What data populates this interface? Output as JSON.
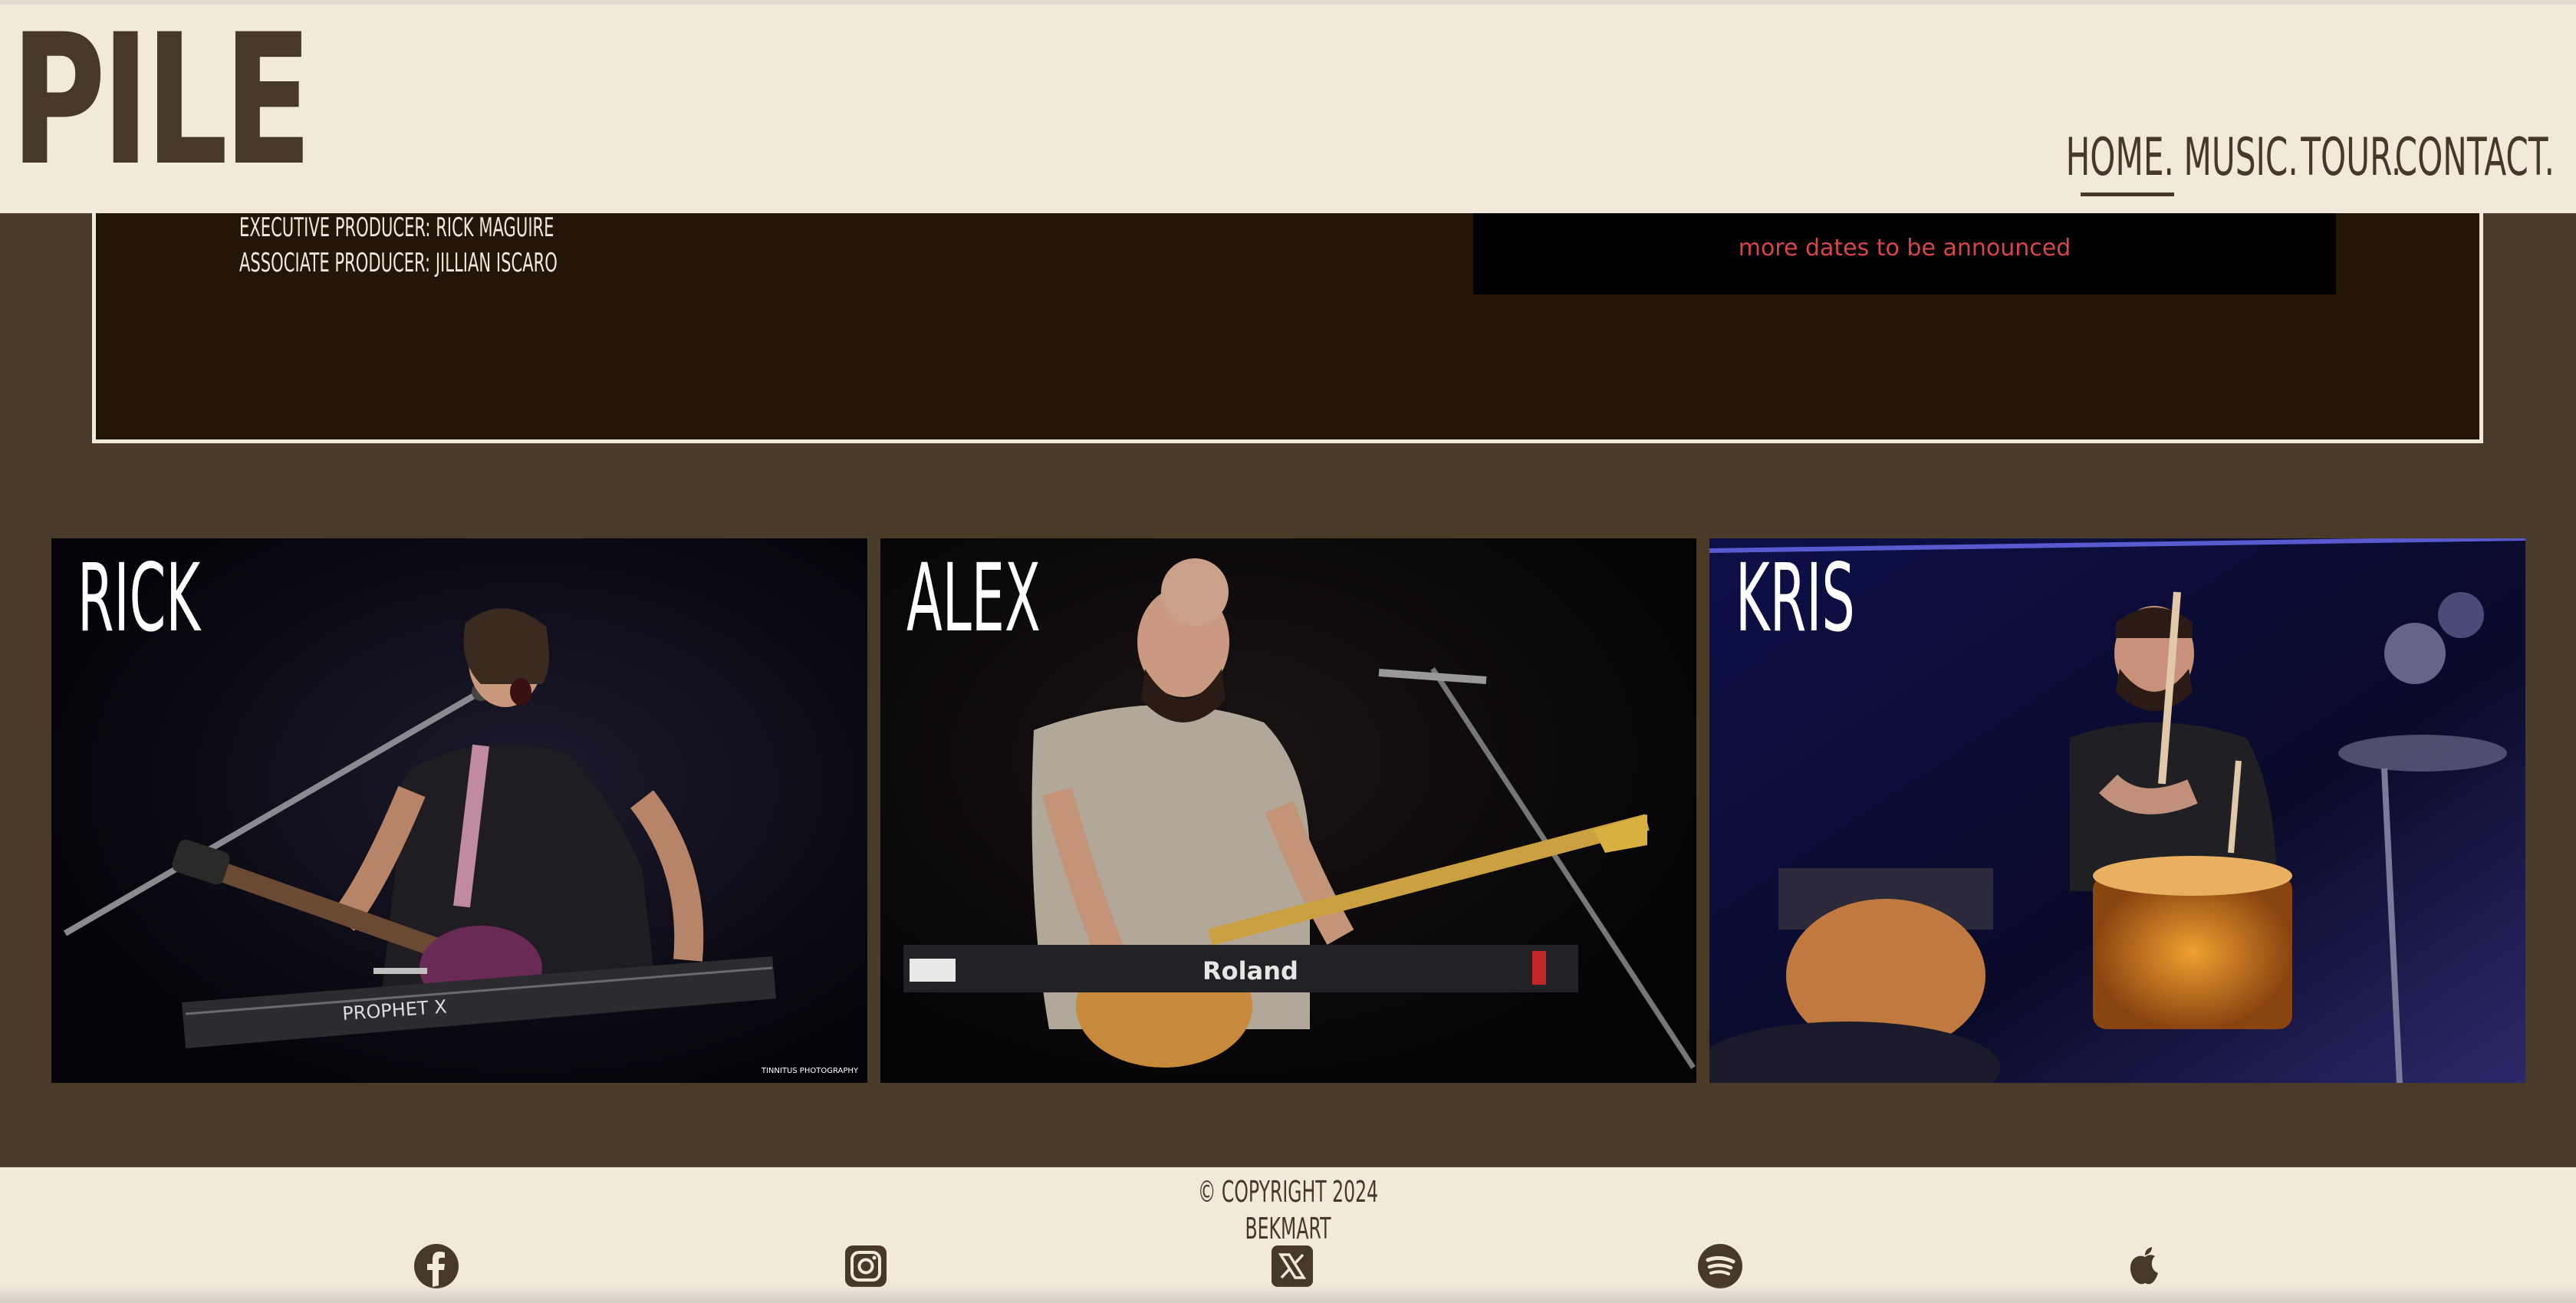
{
  "header": {
    "logo": "PILE",
    "nav": [
      {
        "label": "HOME.",
        "active": true
      },
      {
        "label": "MUSIC.",
        "active": false
      },
      {
        "label": "TOUR.",
        "active": false
      },
      {
        "label": "CONTACT.",
        "active": false
      }
    ]
  },
  "album_credits": [
    "EXECUTIVE PRODUCER: RICK MAGUIRE",
    "ASSOCIATE PRODUCER: JILLIAN ISCARO"
  ],
  "tour": {
    "note": "more dates to be announced"
  },
  "members": [
    {
      "name": "RICK"
    },
    {
      "name": "ALEX"
    },
    {
      "name": "KRIS"
    }
  ],
  "photo_credit": "TINNITUS PHOTOGRAPHY",
  "keyboard_labels": {
    "rick": "PROPHET X",
    "alex": "Roland"
  },
  "footer": {
    "copyright": "© COPYRIGHT 2024",
    "credit": "BEKMART",
    "social_icons": [
      "facebook-icon",
      "instagram-icon",
      "x-twitter-icon",
      "spotify-icon",
      "apple-music-icon"
    ]
  },
  "colors": {
    "cream": "#f2e9dd",
    "brown": "#47392a",
    "page_background": "#4a3a2a",
    "panel_dark": "#231606",
    "announce_red": "#d8464b"
  }
}
